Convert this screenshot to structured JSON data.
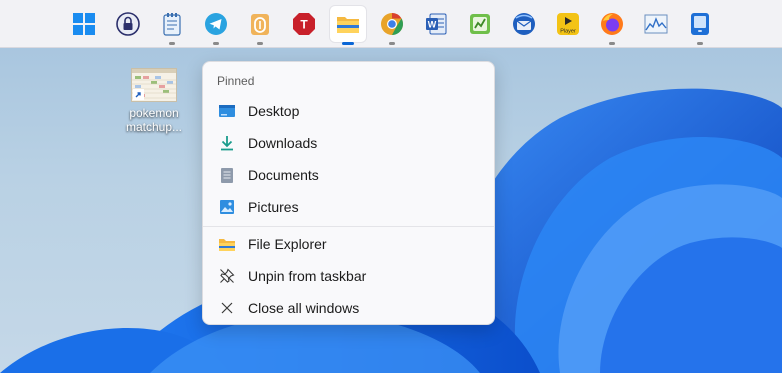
{
  "taskbar": {
    "apps": [
      {
        "icon": "windows-start-icon",
        "indicator": false,
        "active": false
      },
      {
        "icon": "keepass-lock-icon",
        "indicator": false,
        "active": false
      },
      {
        "icon": "notepad-icon",
        "indicator": true,
        "active": false
      },
      {
        "icon": "telegram-icon",
        "indicator": true,
        "active": false
      },
      {
        "icon": "clipboard-app-icon",
        "indicator": true,
        "active": false
      },
      {
        "icon": "red-t-app-icon",
        "indicator": false,
        "active": false
      },
      {
        "icon": "file-explorer-icon",
        "indicator": true,
        "active": true
      },
      {
        "icon": "chrome-canary-icon",
        "indicator": true,
        "active": false
      },
      {
        "icon": "word-icon",
        "indicator": false,
        "active": false
      },
      {
        "icon": "green-app-icon",
        "indicator": false,
        "active": false
      },
      {
        "icon": "thunderbird-icon",
        "indicator": false,
        "active": false
      },
      {
        "icon": "player-app-icon",
        "indicator": false,
        "active": false
      },
      {
        "icon": "firefox-icon",
        "indicator": true,
        "active": false
      },
      {
        "icon": "resource-monitor-icon",
        "indicator": false,
        "active": false
      },
      {
        "icon": "phone-link-icon",
        "indicator": true,
        "active": false
      }
    ],
    "player_label": "Player"
  },
  "desktop": {
    "shortcut": {
      "label_line1": "pokemon",
      "label_line2": "matchup..."
    }
  },
  "jump_list": {
    "header": "Pinned",
    "pinned": [
      {
        "label": "Desktop",
        "icon": "desktop-folder-icon"
      },
      {
        "label": "Downloads",
        "icon": "downloads-arrow-icon"
      },
      {
        "label": "Documents",
        "icon": "documents-icon"
      },
      {
        "label": "Pictures",
        "icon": "pictures-icon"
      }
    ],
    "tasks": [
      {
        "label": "File Explorer",
        "icon": "file-explorer-icon"
      },
      {
        "label": "Unpin from taskbar",
        "icon": "unpin-icon"
      },
      {
        "label": "Close all windows",
        "icon": "close-icon"
      }
    ]
  },
  "colors": {
    "accent": "#0a66d6",
    "wallpaper_blue": "#0b5fd8"
  }
}
